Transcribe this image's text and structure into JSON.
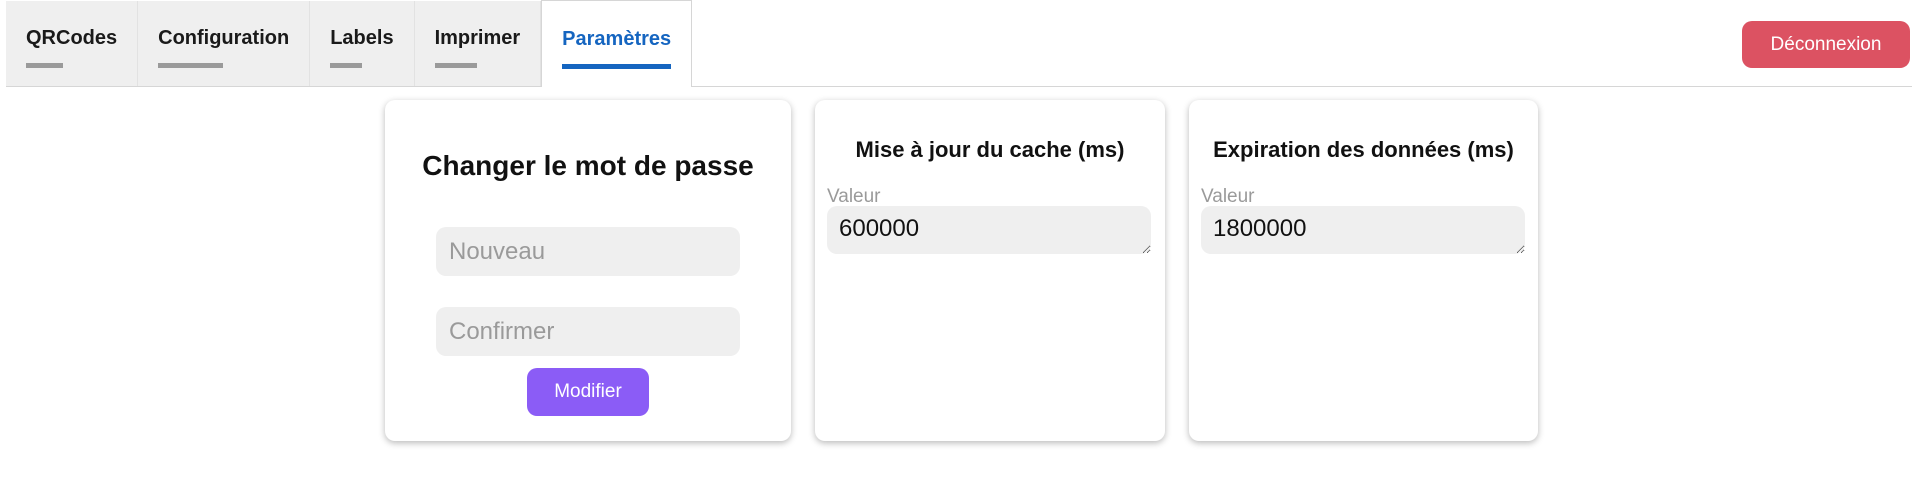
{
  "tabs": [
    {
      "label": "QRCodes",
      "active": false
    },
    {
      "label": "Configuration",
      "active": false
    },
    {
      "label": "Labels",
      "active": false
    },
    {
      "label": "Imprimer",
      "active": false
    },
    {
      "label": "Paramètres",
      "active": true
    }
  ],
  "header": {
    "logout_label": "Déconnexion"
  },
  "password_card": {
    "title": "Changer le mot de passe",
    "new_placeholder": "Nouveau",
    "confirm_placeholder": "Confirmer",
    "submit_label": "Modifier"
  },
  "cache_card": {
    "title": "Mise à jour du cache (ms)",
    "field_label": "Valeur",
    "value": "600000"
  },
  "expiration_card": {
    "title": "Expiration des données (ms)",
    "field_label": "Valeur",
    "value": "1800000"
  },
  "colors": {
    "active_tab": "#1565c0",
    "logout_button": "#dc5262",
    "submit_button": "#8b5cf6",
    "inactive_underline": "#9a9a9a"
  }
}
